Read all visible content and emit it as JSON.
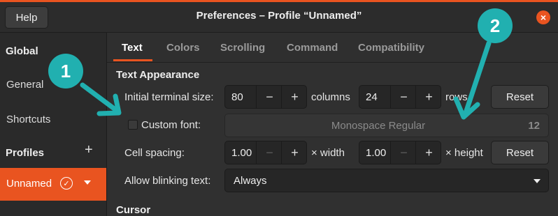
{
  "header": {
    "help_label": "Help",
    "title": "Preferences – Profile “Unnamed”",
    "close_glyph": "×"
  },
  "sidebar": {
    "global_heading": "Global",
    "items": [
      {
        "label": "General"
      },
      {
        "label": "Shortcuts"
      }
    ],
    "profiles_heading": "Profiles",
    "add_glyph": "+",
    "selected_profile": {
      "label": "Unnamed",
      "check_glyph": "✓"
    }
  },
  "tabs": [
    {
      "label": "Text",
      "active": true
    },
    {
      "label": "Colors"
    },
    {
      "label": "Scrolling"
    },
    {
      "label": "Command"
    },
    {
      "label": "Compatibility"
    }
  ],
  "text_appearance": {
    "heading": "Text Appearance",
    "terminal_size": {
      "label": "Initial terminal size:",
      "columns": "80",
      "columns_unit": "columns",
      "rows": "24",
      "rows_unit": "rows",
      "reset_label": "Reset"
    },
    "custom_font": {
      "label": "Custom font:",
      "checked": false,
      "font_name": "Monospace Regular",
      "font_size": "12"
    },
    "cell_spacing": {
      "label": "Cell spacing:",
      "width_value": "1.00",
      "width_unit": "× width",
      "height_value": "1.00",
      "height_unit": "× height",
      "reset_label": "Reset"
    },
    "blinking": {
      "label": "Allow blinking text:",
      "value": "Always"
    }
  },
  "cursor_heading": "Cursor",
  "stepper": {
    "minus": "−",
    "plus": "+"
  },
  "annotations": [
    {
      "number": "1"
    },
    {
      "number": "2"
    }
  ],
  "colors": {
    "accent": "#e95420",
    "callout": "#21b0b0"
  }
}
